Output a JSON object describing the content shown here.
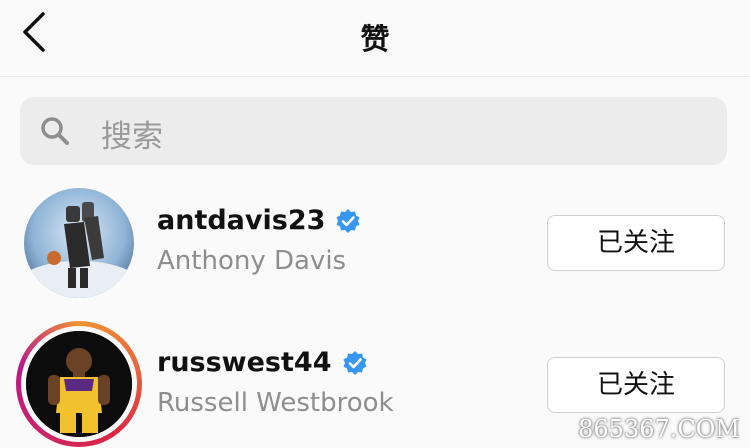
{
  "header": {
    "title": "赞",
    "back_icon": "chevron-left-icon"
  },
  "search": {
    "placeholder": "搜索",
    "icon": "search-icon"
  },
  "users": [
    {
      "username": "antdavis23",
      "full_name": "Anthony Davis",
      "verified": true,
      "follow_button": "已关注",
      "has_story_ring": false
    },
    {
      "username": "russwest44",
      "full_name": "Russell Westbrook",
      "verified": true,
      "follow_button": "已关注",
      "has_story_ring": true
    }
  ],
  "watermark": "865367.COM",
  "colors": {
    "verified": "#3897f0",
    "background": "#fafafa",
    "secondary_text": "#8e8e8e"
  }
}
